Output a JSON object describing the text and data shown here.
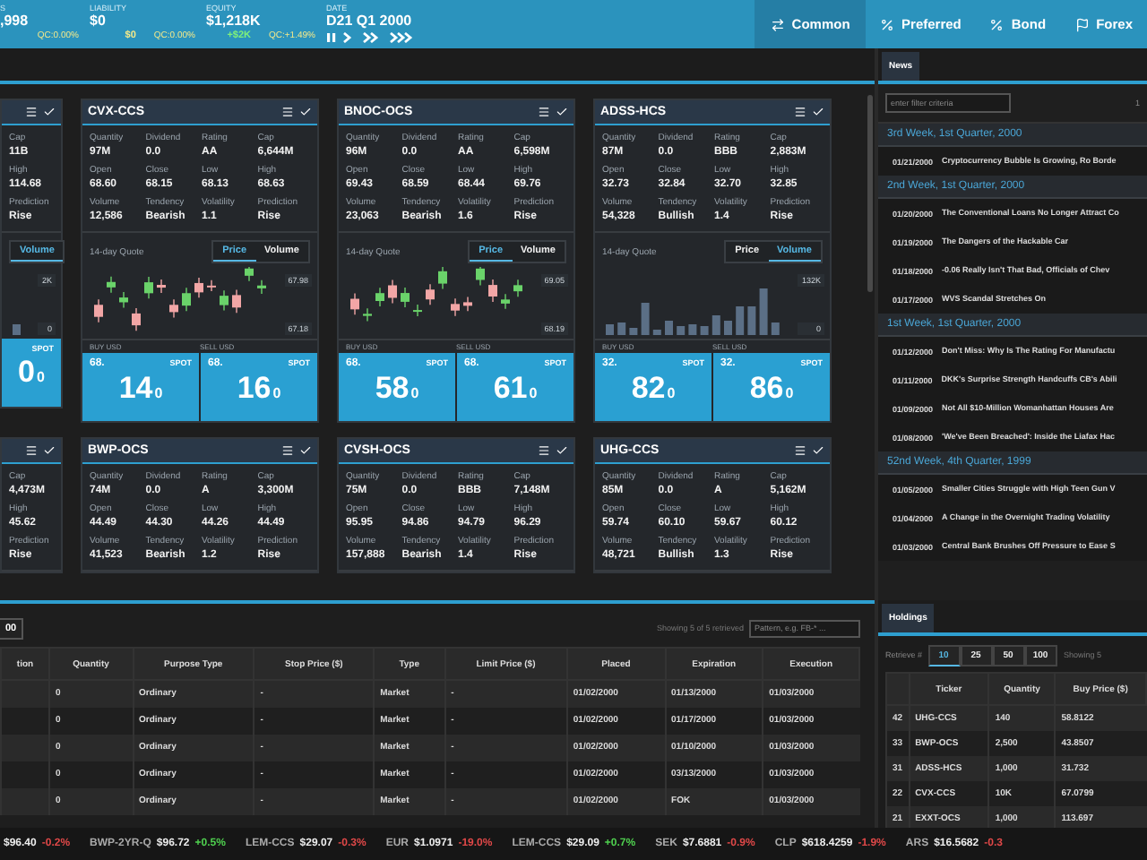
{
  "top_stats": [
    {
      "label": "S",
      "value": ",998",
      "qc": "QC:0.00%"
    },
    {
      "label": "LIABILITY",
      "value": "$0",
      "change": "$0",
      "color": "#f3e98a",
      "qc": "QC:0.00%"
    },
    {
      "label": "EQUITY",
      "value": "$1,218K",
      "change": "+$2K",
      "color": "#7ff07a",
      "qc": "QC:+1.49%"
    }
  ],
  "date": {
    "label": "DATE",
    "value": "D21 Q1 2000"
  },
  "asset_tabs": [
    {
      "label": "Common",
      "kind": "swap",
      "selected": true
    },
    {
      "label": "Preferred",
      "kind": "percent",
      "selected": false
    },
    {
      "label": "Bond",
      "kind": "percent",
      "selected": false
    },
    {
      "label": "Forex",
      "kind": "flag",
      "selected": false
    }
  ],
  "card_rows": [
    [
      {
        "kind": "clipped",
        "stats": [
          {
            "label": "Cap",
            "value": "11B"
          },
          {
            "label": "High",
            "value": "114.68"
          },
          {
            "label": "Prediction",
            "value": "Rise"
          }
        ],
        "quote": {
          "tabs": [
            {
              "label": "Volume",
              "selected": true
            }
          ],
          "axis": [
            "2K",
            "0"
          ]
        },
        "spots": [
          {
            "big": "0",
            "small": "0",
            "label": "SPOT"
          }
        ]
      },
      {
        "kind": "full",
        "name": "CVX-CCS",
        "stats": [
          {
            "label": "Quantity",
            "value": "97M"
          },
          {
            "label": "Dividend",
            "value": "0.0"
          },
          {
            "label": "Rating",
            "value": "AA"
          },
          {
            "label": "Cap",
            "value": "6,644M"
          },
          {
            "label": "Open",
            "value": "68.60"
          },
          {
            "label": "Close",
            "value": "68.15"
          },
          {
            "label": "Low",
            "value": "68.13"
          },
          {
            "label": "High",
            "value": "68.63"
          },
          {
            "label": "Volume",
            "value": "12,586"
          },
          {
            "label": "Tendency",
            "value": "Bearish"
          },
          {
            "label": "Volatility",
            "value": "1.1"
          },
          {
            "label": "Prediction",
            "value": "Rise"
          }
        ],
        "quote": {
          "title": "14-day Quote",
          "tabs": [
            {
              "label": "Price",
              "selected": true
            },
            {
              "label": "Volume",
              "selected": false
            }
          ],
          "axis": [
            "67.98",
            "67.18"
          ],
          "buy_label": "BUY USD",
          "sell_label": "SELL USD"
        },
        "spots": [
          {
            "prefix": "68.",
            "big": "14",
            "small": "0",
            "label": "SPOT"
          },
          {
            "prefix": "68.",
            "big": "16",
            "small": "0",
            "label": "SPOT"
          }
        ]
      },
      {
        "kind": "full",
        "name": "BNOC-OCS",
        "stats": [
          {
            "label": "Quantity",
            "value": "96M"
          },
          {
            "label": "Dividend",
            "value": "0.0"
          },
          {
            "label": "Rating",
            "value": "AA"
          },
          {
            "label": "Cap",
            "value": "6,598M"
          },
          {
            "label": "Open",
            "value": "69.43"
          },
          {
            "label": "Close",
            "value": "68.59"
          },
          {
            "label": "Low",
            "value": "68.44"
          },
          {
            "label": "High",
            "value": "69.76"
          },
          {
            "label": "Volume",
            "value": "23,063"
          },
          {
            "label": "Tendency",
            "value": "Bearish"
          },
          {
            "label": "Volatility",
            "value": "1.6"
          },
          {
            "label": "Prediction",
            "value": "Rise"
          }
        ],
        "quote": {
          "title": "14-day Quote",
          "tabs": [
            {
              "label": "Price",
              "selected": true
            },
            {
              "label": "Volume",
              "selected": false
            }
          ],
          "axis": [
            "69.05",
            "68.19"
          ],
          "buy_label": "BUY USD",
          "sell_label": "SELL USD"
        },
        "spots": [
          {
            "prefix": "68.",
            "big": "58",
            "small": "0",
            "label": "SPOT"
          },
          {
            "prefix": "68.",
            "big": "61",
            "small": "0",
            "label": "SPOT"
          }
        ]
      },
      {
        "kind": "full",
        "name": "ADSS-HCS",
        "stats": [
          {
            "label": "Quantity",
            "value": "87M"
          },
          {
            "label": "Dividend",
            "value": "0.0"
          },
          {
            "label": "Rating",
            "value": "BBB"
          },
          {
            "label": "Cap",
            "value": "2,883M"
          },
          {
            "label": "Open",
            "value": "32.73"
          },
          {
            "label": "Close",
            "value": "32.84"
          },
          {
            "label": "Low",
            "value": "32.70"
          },
          {
            "label": "High",
            "value": "32.85"
          },
          {
            "label": "Volume",
            "value": "54,328"
          },
          {
            "label": "Tendency",
            "value": "Bullish"
          },
          {
            "label": "Volatility",
            "value": "1.4"
          },
          {
            "label": "Prediction",
            "value": "Rise"
          }
        ],
        "quote": {
          "title": "14-day Quote",
          "tabs": [
            {
              "label": "Price",
              "selected": false
            },
            {
              "label": "Volume",
              "selected": true
            }
          ],
          "axis": [
            "132K",
            "0"
          ],
          "buy_label": "BUY USD",
          "sell_label": "SELL USD"
        },
        "spots": [
          {
            "prefix": "32.",
            "big": "82",
            "small": "0",
            "label": "SPOT"
          },
          {
            "prefix": "32.",
            "big": "86",
            "small": "0",
            "label": "SPOT"
          }
        ]
      }
    ],
    [
      {
        "kind": "clipped",
        "stats": [
          {
            "label": "Cap",
            "value": "4,473M"
          },
          {
            "label": "High",
            "value": "45.62"
          },
          {
            "label": "Prediction",
            "value": "Rise"
          }
        ]
      },
      {
        "kind": "full",
        "name": "BWP-OCS",
        "stats": [
          {
            "label": "Quantity",
            "value": "74M"
          },
          {
            "label": "Dividend",
            "value": "0.0"
          },
          {
            "label": "Rating",
            "value": "A"
          },
          {
            "label": "Cap",
            "value": "3,300M"
          },
          {
            "label": "Open",
            "value": "44.49"
          },
          {
            "label": "Close",
            "value": "44.30"
          },
          {
            "label": "Low",
            "value": "44.26"
          },
          {
            "label": "High",
            "value": "44.49"
          },
          {
            "label": "Volume",
            "value": "41,523"
          },
          {
            "label": "Tendency",
            "value": "Bearish"
          },
          {
            "label": "Volatility",
            "value": "1.2"
          },
          {
            "label": "Prediction",
            "value": "Rise"
          }
        ]
      },
      {
        "kind": "full",
        "name": "CVSH-OCS",
        "stats": [
          {
            "label": "Quantity",
            "value": "75M"
          },
          {
            "label": "Dividend",
            "value": "0.0"
          },
          {
            "label": "Rating",
            "value": "BBB"
          },
          {
            "label": "Cap",
            "value": "7,148M"
          },
          {
            "label": "Open",
            "value": "95.95"
          },
          {
            "label": "Close",
            "value": "94.86"
          },
          {
            "label": "Low",
            "value": "94.79"
          },
          {
            "label": "High",
            "value": "96.29"
          },
          {
            "label": "Volume",
            "value": "157,888"
          },
          {
            "label": "Tendency",
            "value": "Bearish"
          },
          {
            "label": "Volatility",
            "value": "1.4"
          },
          {
            "label": "Prediction",
            "value": "Rise"
          }
        ]
      },
      {
        "kind": "full",
        "name": "UHG-CCS",
        "stats": [
          {
            "label": "Quantity",
            "value": "85M"
          },
          {
            "label": "Dividend",
            "value": "0.0"
          },
          {
            "label": "Rating",
            "value": "A"
          },
          {
            "label": "Cap",
            "value": "5,162M"
          },
          {
            "label": "Open",
            "value": "59.74"
          },
          {
            "label": "Close",
            "value": "60.10"
          },
          {
            "label": "Low",
            "value": "59.67"
          },
          {
            "label": "High",
            "value": "60.12"
          },
          {
            "label": "Volume",
            "value": "48,721"
          },
          {
            "label": "Tendency",
            "value": "Bullish"
          },
          {
            "label": "Volatility",
            "value": "1.3"
          },
          {
            "label": "Prediction",
            "value": "Rise"
          }
        ]
      }
    ]
  ],
  "orders": {
    "page_button": "00",
    "status": "Showing 5 of 5 retrieved",
    "filter": {
      "placeholder": "Pattern, e.g. FB-* ..."
    },
    "columns": [
      "tion",
      "Quantity",
      "Purpose Type",
      "Stop Price ($)",
      "Type",
      "Limit Price ($)",
      "Placed",
      "Expiration",
      "Execution"
    ],
    "rows": [
      [
        "",
        "0",
        "Ordinary",
        "-",
        "Market",
        "-",
        "01/02/2000",
        "01/13/2000",
        "01/03/2000"
      ],
      [
        "",
        "0",
        "Ordinary",
        "-",
        "Market",
        "-",
        "01/02/2000",
        "01/17/2000",
        "01/03/2000"
      ],
      [
        "",
        "0",
        "Ordinary",
        "-",
        "Market",
        "-",
        "01/02/2000",
        "01/10/2000",
        "01/03/2000"
      ],
      [
        "",
        "0",
        "Ordinary",
        "-",
        "Market",
        "-",
        "01/02/2000",
        "03/13/2000",
        "01/03/2000"
      ],
      [
        "",
        "0",
        "Ordinary",
        "-",
        "Market",
        "-",
        "01/02/2000",
        "FOK",
        "01/03/2000"
      ]
    ]
  },
  "news": {
    "tab": "News",
    "filter": {
      "placeholder": "enter filter criteria"
    },
    "filter_count": "1",
    "groups": [
      {
        "title": "3rd Week, 1st Quarter, 2000",
        "items": [
          {
            "date": "01/21/2000",
            "headline": "Cryptocurrency Bubble Is Growing, Ro Borde"
          }
        ]
      },
      {
        "title": "2nd Week, 1st Quarter, 2000",
        "items": [
          {
            "date": "01/20/2000",
            "headline": "The Conventional Loans No Longer Attract Co"
          },
          {
            "date": "01/19/2000",
            "headline": "The Dangers of the Hackable Car"
          },
          {
            "date": "01/18/2000",
            "headline": "-0.06 Really Isn't That Bad, Officials of Chev"
          },
          {
            "date": "01/17/2000",
            "headline": "WVS Scandal Stretches On"
          }
        ]
      },
      {
        "title": "1st Week, 1st Quarter, 2000",
        "items": [
          {
            "date": "01/12/2000",
            "headline": "Don't Miss: Why Is The Rating For Manufactu"
          },
          {
            "date": "01/11/2000",
            "headline": "DKK's Surprise Strength Handcuffs CB's Abili"
          },
          {
            "date": "01/09/2000",
            "headline": "Not All $10-Million Womanhattan Houses Are"
          },
          {
            "date": "01/08/2000",
            "headline": "'We've Been Breached': Inside the Liafax Hac"
          }
        ]
      },
      {
        "title": "52nd Week, 4th Quarter, 1999",
        "items": [
          {
            "date": "01/05/2000",
            "headline": "Smaller Cities Struggle with High Teen Gun V"
          },
          {
            "date": "01/04/2000",
            "headline": "A Change in the Overnight Trading Volatility"
          },
          {
            "date": "01/03/2000",
            "headline": "Central Bank Brushes Off Pressure to Ease S"
          }
        ]
      }
    ]
  },
  "holdings": {
    "tab": "Holdings",
    "retrieve_label": "Retrieve #",
    "page_sizes": [
      {
        "label": "10",
        "selected": true
      },
      {
        "label": "25",
        "selected": false
      },
      {
        "label": "50",
        "selected": false
      },
      {
        "label": "100",
        "selected": false
      }
    ],
    "status": "Showing 5",
    "columns": [
      "",
      "Ticker",
      "Quantity",
      "Buy Price ($)"
    ],
    "rows": [
      [
        "42",
        "UHG-CCS",
        "140",
        "58.8122"
      ],
      [
        "33",
        "BWP-OCS",
        "2,500",
        "43.8507"
      ],
      [
        "31",
        "ADSS-HCS",
        "1,000",
        "31.732"
      ],
      [
        "22",
        "CVX-CCS",
        "10K",
        "67.0799"
      ],
      [
        "21",
        "EXXT-OCS",
        "1,000",
        "113.697"
      ]
    ]
  },
  "ticker": [
    {
      "price": "$96.40",
      "change": "-0.2%",
      "color": "#e04848"
    },
    {
      "symbol": "BWP-2YR-Q",
      "price": "$96.72",
      "change": "+0.5%",
      "color": "#4fd04f"
    },
    {
      "symbol": "LEM-CCS",
      "price": "$29.07",
      "change": "-0.3%",
      "color": "#e04848"
    },
    {
      "symbol": "EUR",
      "price": "$1.0971",
      "change": "-19.0%",
      "color": "#e04848"
    },
    {
      "symbol": "LEM-CCS",
      "price": "$29.09",
      "change": "+0.7%",
      "color": "#4fd04f"
    },
    {
      "symbol": "SEK",
      "price": "$7.6881",
      "change": "-0.9%",
      "color": "#e04848"
    },
    {
      "symbol": "CLP",
      "price": "$618.4259",
      "change": "-1.9%",
      "color": "#e04848"
    },
    {
      "symbol": "ARS",
      "price": "$16.5682",
      "change": "-0.3",
      "color": "#e04848"
    }
  ]
}
